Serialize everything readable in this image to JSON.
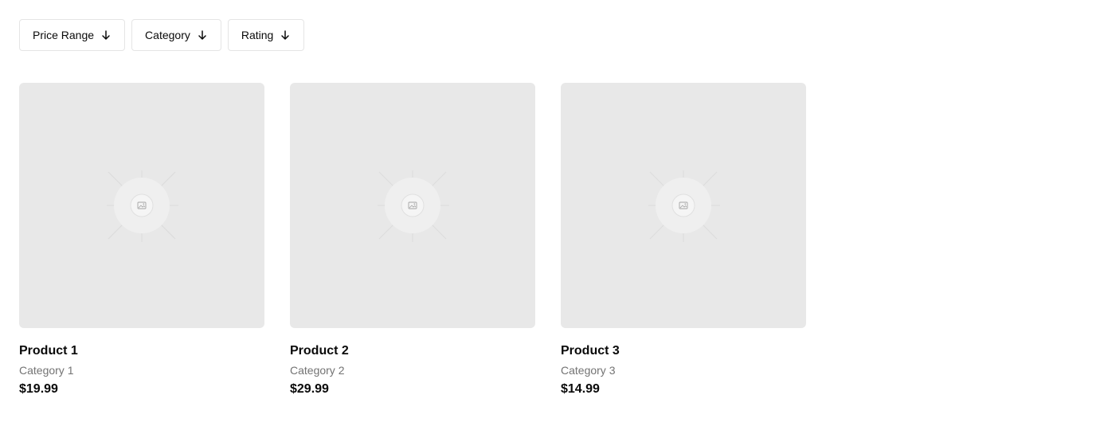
{
  "filters": [
    {
      "label": "Price Range",
      "icon": "arrow-down-icon"
    },
    {
      "label": "Category",
      "icon": "arrow-down-icon"
    },
    {
      "label": "Rating",
      "icon": "arrow-down-icon"
    }
  ],
  "products": [
    {
      "name": "Product 1",
      "category": "Category 1",
      "price": "$19.99",
      "image_icon": "image-placeholder-icon"
    },
    {
      "name": "Product 2",
      "category": "Category 2",
      "price": "$29.99",
      "image_icon": "image-placeholder-icon"
    },
    {
      "name": "Product 3",
      "category": "Category 3",
      "price": "$14.99",
      "image_icon": "image-placeholder-icon"
    }
  ],
  "colors": {
    "text": "#0a0a0a",
    "muted": "#737373",
    "border": "#e5e5e5",
    "placeholder": "#e8e8e8"
  }
}
